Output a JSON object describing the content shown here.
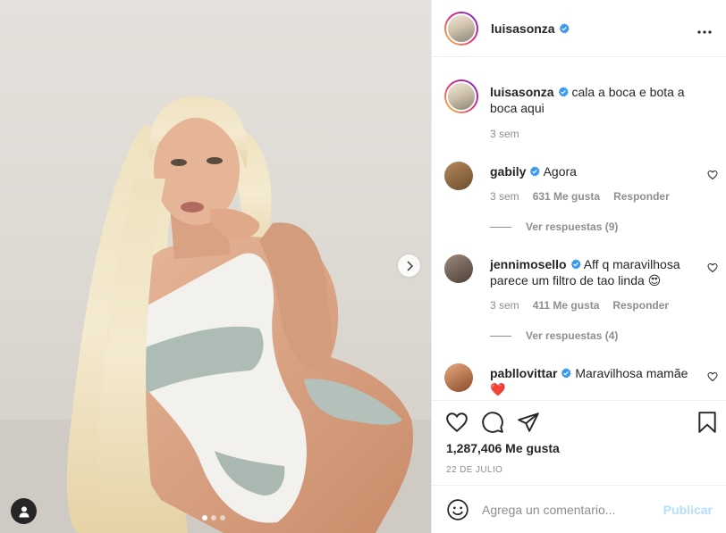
{
  "post": {
    "username": "luisasonza",
    "verified": true,
    "more_icon": "more-horizontal-icon",
    "colors": {
      "verified": "#3897f0",
      "link_muted": "#8e8e8e",
      "publish_disabled": "#b2dffc",
      "heart_red": "#ed4956"
    }
  },
  "media": {
    "carousel_count": 3,
    "carousel_active": 1,
    "next_icon": "chevron-right-icon",
    "tag_icon": "user-tag-icon"
  },
  "caption": {
    "username": "luisasonza",
    "text": "cala a boca e bota a boca aqui",
    "time": "3 sem"
  },
  "comments": [
    {
      "username": "gabily",
      "text": "Agora",
      "time": "3 sem",
      "likes": "631 Me gusta",
      "reply": "Responder",
      "view_replies": "Ver respuestas (9)"
    },
    {
      "username": "jennimosello",
      "text": "Aff q maravilhosa parece um filtro de tao linda 😍",
      "time": "3 sem",
      "likes": "411 Me gusta",
      "reply": "Responder",
      "view_replies": "Ver respuestas (4)"
    },
    {
      "username": "pabllovittar",
      "text": "Maravilhosa mamãe ❤️"
    }
  ],
  "actions": {
    "like_icon": "heart-icon",
    "comment_icon": "comment-icon",
    "share_icon": "send-icon",
    "save_icon": "bookmark-icon",
    "likes_count": "1,287,406 Me gusta",
    "date": "22 DE JULIO"
  },
  "add_comment": {
    "emoji_icon": "emoji-icon",
    "placeholder": "Agrega un comentario...",
    "publish_label": "Publicar"
  }
}
